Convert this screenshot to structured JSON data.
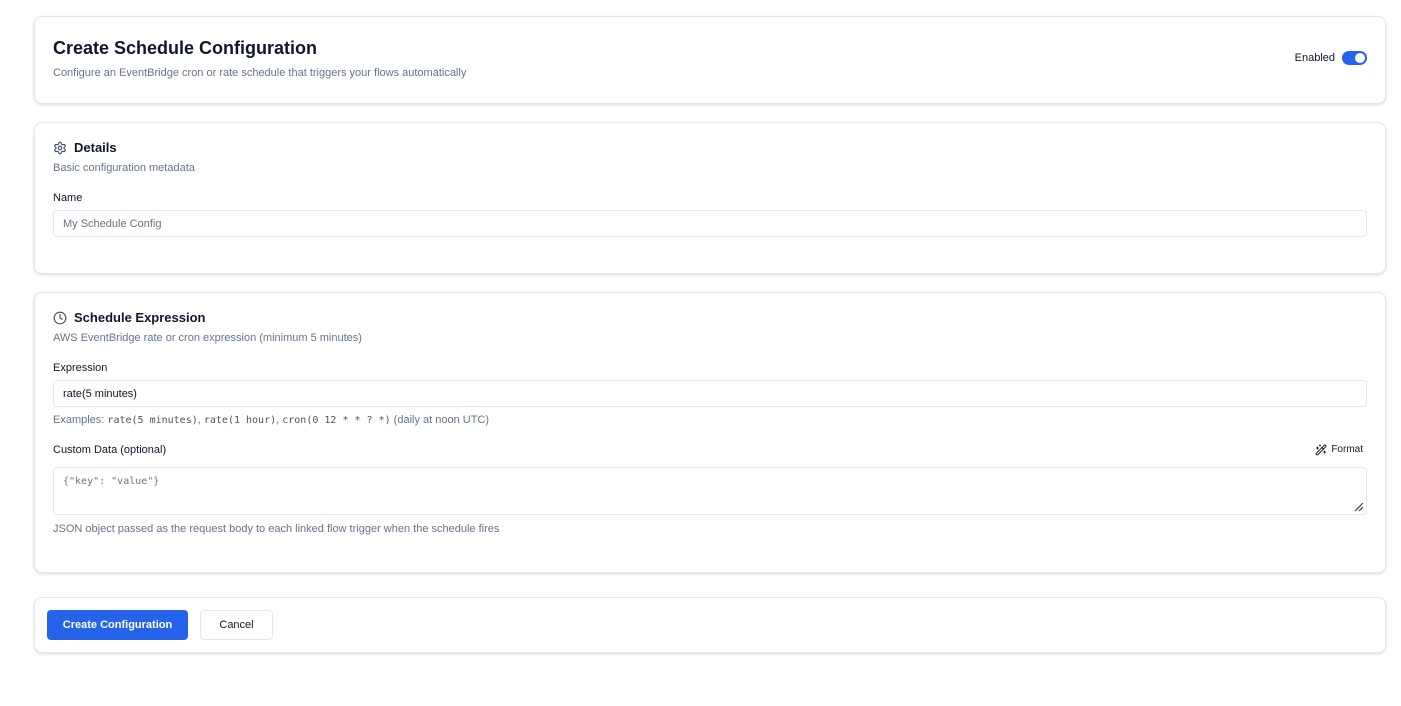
{
  "header": {
    "title": "Create Schedule Configuration",
    "subtitle": "Configure an EventBridge cron or rate schedule that triggers your flows automatically",
    "toggle_label": "Enabled",
    "enabled": true
  },
  "details": {
    "icon": "gear-icon",
    "title": "Details",
    "description": "Basic configuration metadata",
    "name_label": "Name",
    "name_placeholder": "My Schedule Config",
    "name_value": ""
  },
  "schedule": {
    "icon": "clock-icon",
    "title": "Schedule Expression",
    "description": "AWS EventBridge rate or cron expression (minimum 5 minutes)",
    "expression_label": "Expression",
    "expression_value": "rate(5 minutes)",
    "examples": {
      "prefix": "Examples: ",
      "ex1": "rate(5 minutes)",
      "sep1": ", ",
      "ex2": "rate(1 hour)",
      "sep2": ", ",
      "ex3": "cron(0 12 * * ? *)",
      "suffix": " (daily at noon UTC)"
    },
    "custom_data_label": "Custom Data (optional)",
    "format_label": "Format",
    "format_icon": "magic-wand-icon",
    "custom_data_placeholder": "{\"key\": \"value\"}",
    "custom_data_hint": "JSON object passed as the request body to each linked flow trigger when the schedule fires"
  },
  "actions": {
    "create_label": "Create Configuration",
    "cancel_label": "Cancel"
  },
  "colors": {
    "primary": "#2563eb",
    "muted_text": "#64748b",
    "border": "#e4e7ec"
  }
}
